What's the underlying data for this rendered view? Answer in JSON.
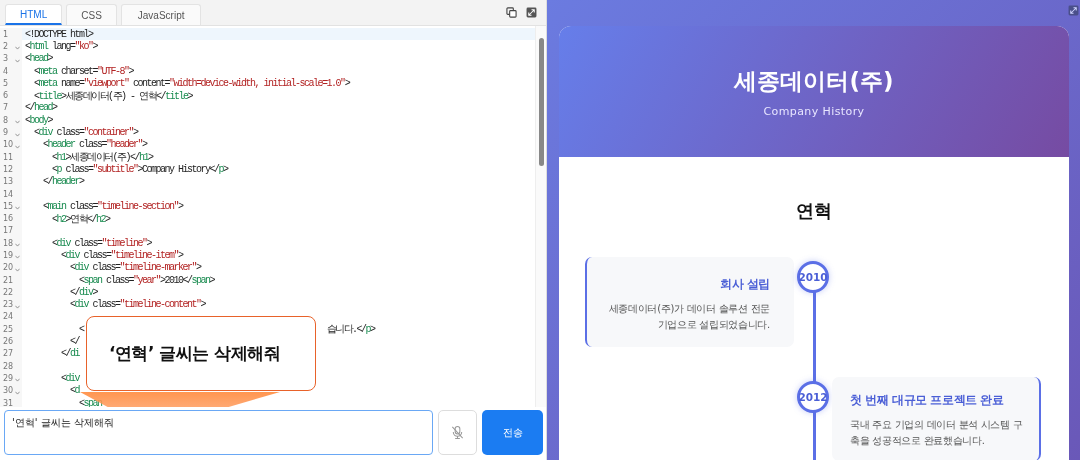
{
  "editor": {
    "tabs": [
      {
        "label": "HTML",
        "selected": true
      },
      {
        "label": "CSS",
        "selected": false
      },
      {
        "label": "JavaScript",
        "selected": false
      }
    ],
    "lines": [
      {
        "number": "1",
        "foldable": false,
        "current": true,
        "segments": [
          {
            "kind": "plain",
            "text": "<!DOCTYPE html>"
          }
        ]
      },
      {
        "number": "2",
        "foldable": true,
        "current": false,
        "segments": [
          {
            "kind": "plain",
            "text": "<"
          },
          {
            "kind": "tag",
            "text": "html"
          },
          {
            "kind": "plain",
            "text": " lang="
          },
          {
            "kind": "string",
            "text": "\"ko\""
          },
          {
            "kind": "plain",
            "text": ">"
          }
        ]
      },
      {
        "number": "3",
        "foldable": true,
        "current": false,
        "segments": [
          {
            "kind": "plain",
            "text": "<"
          },
          {
            "kind": "tag",
            "text": "head"
          },
          {
            "kind": "plain",
            "text": ">"
          }
        ]
      },
      {
        "number": "4",
        "foldable": false,
        "current": false,
        "segments": [
          {
            "kind": "plain",
            "text": "  <"
          },
          {
            "kind": "tag",
            "text": "meta"
          },
          {
            "kind": "plain",
            "text": " charset="
          },
          {
            "kind": "string",
            "text": "\"UTF-8\""
          },
          {
            "kind": "plain",
            "text": ">"
          }
        ]
      },
      {
        "number": "5",
        "foldable": false,
        "current": false,
        "segments": [
          {
            "kind": "plain",
            "text": "  <"
          },
          {
            "kind": "tag",
            "text": "meta"
          },
          {
            "kind": "plain",
            "text": " name="
          },
          {
            "kind": "string",
            "text": "\"viewport\""
          },
          {
            "kind": "plain",
            "text": " content="
          },
          {
            "kind": "string",
            "text": "\"width=device-width, initial-scale=1.0\""
          },
          {
            "kind": "plain",
            "text": ">"
          }
        ]
      },
      {
        "number": "6",
        "foldable": false,
        "current": false,
        "segments": [
          {
            "kind": "plain",
            "text": "  <"
          },
          {
            "kind": "tag",
            "text": "title"
          },
          {
            "kind": "plain",
            "text": ">세종데이터(주) - 연혁</"
          },
          {
            "kind": "tag",
            "text": "title"
          },
          {
            "kind": "plain",
            "text": ">"
          }
        ]
      },
      {
        "number": "7",
        "foldable": false,
        "current": false,
        "segments": [
          {
            "kind": "plain",
            "text": "</"
          },
          {
            "kind": "tag",
            "text": "head"
          },
          {
            "kind": "plain",
            "text": ">"
          }
        ]
      },
      {
        "number": "8",
        "foldable": true,
        "current": false,
        "segments": [
          {
            "kind": "plain",
            "text": "<"
          },
          {
            "kind": "tag",
            "text": "body"
          },
          {
            "kind": "plain",
            "text": ">"
          }
        ]
      },
      {
        "number": "9",
        "foldable": true,
        "current": false,
        "segments": [
          {
            "kind": "plain",
            "text": "  <"
          },
          {
            "kind": "tag",
            "text": "div"
          },
          {
            "kind": "plain",
            "text": " class="
          },
          {
            "kind": "string",
            "text": "\"container\""
          },
          {
            "kind": "plain",
            "text": ">"
          }
        ]
      },
      {
        "number": "10",
        "foldable": true,
        "current": false,
        "segments": [
          {
            "kind": "plain",
            "text": "    <"
          },
          {
            "kind": "tag",
            "text": "header"
          },
          {
            "kind": "plain",
            "text": " class="
          },
          {
            "kind": "string",
            "text": "\"header\""
          },
          {
            "kind": "plain",
            "text": ">"
          }
        ]
      },
      {
        "number": "11",
        "foldable": false,
        "current": false,
        "segments": [
          {
            "kind": "plain",
            "text": "      <"
          },
          {
            "kind": "tag",
            "text": "h1"
          },
          {
            "kind": "plain",
            "text": ">세종데이터(주)</"
          },
          {
            "kind": "tag",
            "text": "h1"
          },
          {
            "kind": "plain",
            "text": ">"
          }
        ]
      },
      {
        "number": "12",
        "foldable": false,
        "current": false,
        "segments": [
          {
            "kind": "plain",
            "text": "      <"
          },
          {
            "kind": "tag",
            "text": "p"
          },
          {
            "kind": "plain",
            "text": " class="
          },
          {
            "kind": "string",
            "text": "\"subtitle\""
          },
          {
            "kind": "plain",
            "text": ">Company History</"
          },
          {
            "kind": "tag",
            "text": "p"
          },
          {
            "kind": "plain",
            "text": ">"
          }
        ]
      },
      {
        "number": "13",
        "foldable": false,
        "current": false,
        "segments": [
          {
            "kind": "plain",
            "text": "    </"
          },
          {
            "kind": "tag",
            "text": "header"
          },
          {
            "kind": "plain",
            "text": ">"
          }
        ]
      },
      {
        "number": "14",
        "foldable": false,
        "current": false
      },
      {
        "number": "15",
        "foldable": true,
        "current": false,
        "segments": [
          {
            "kind": "plain",
            "text": "    <"
          },
          {
            "kind": "tag",
            "text": "main"
          },
          {
            "kind": "plain",
            "text": " class="
          },
          {
            "kind": "string",
            "text": "\"timeline-section\""
          },
          {
            "kind": "plain",
            "text": ">"
          }
        ]
      },
      {
        "number": "16",
        "foldable": false,
        "current": false,
        "segments": [
          {
            "kind": "plain",
            "text": "      <"
          },
          {
            "kind": "tag",
            "text": "h2"
          },
          {
            "kind": "plain",
            "text": ">연혁</"
          },
          {
            "kind": "tag",
            "text": "h2"
          },
          {
            "kind": "plain",
            "text": ">"
          }
        ]
      },
      {
        "number": "17",
        "foldable": false,
        "current": false
      },
      {
        "number": "18",
        "foldable": true,
        "current": false,
        "segments": [
          {
            "kind": "plain",
            "text": "      <"
          },
          {
            "kind": "tag",
            "text": "div"
          },
          {
            "kind": "plain",
            "text": " class="
          },
          {
            "kind": "string",
            "text": "\"timeline\""
          },
          {
            "kind": "plain",
            "text": ">"
          }
        ]
      },
      {
        "number": "19",
        "foldable": true,
        "current": false,
        "segments": [
          {
            "kind": "plain",
            "text": "        <"
          },
          {
            "kind": "tag",
            "text": "div"
          },
          {
            "kind": "plain",
            "text": " class="
          },
          {
            "kind": "string",
            "text": "\"timeline-item\""
          },
          {
            "kind": "plain",
            "text": ">"
          }
        ]
      },
      {
        "number": "20",
        "foldable": true,
        "current": false,
        "segments": [
          {
            "kind": "plain",
            "text": "          <"
          },
          {
            "kind": "tag",
            "text": "div"
          },
          {
            "kind": "plain",
            "text": " class="
          },
          {
            "kind": "string",
            "text": "\"timeline-marker\""
          },
          {
            "kind": "plain",
            "text": ">"
          }
        ]
      },
      {
        "number": "21",
        "foldable": false,
        "current": false,
        "segments": [
          {
            "kind": "plain",
            "text": "            <"
          },
          {
            "kind": "tag",
            "text": "span"
          },
          {
            "kind": "plain",
            "text": " class="
          },
          {
            "kind": "string",
            "text": "\"year\""
          },
          {
            "kind": "plain",
            "text": ">2010</"
          },
          {
            "kind": "tag",
            "text": "span"
          },
          {
            "kind": "plain",
            "text": ">"
          }
        ]
      },
      {
        "number": "22",
        "foldable": false,
        "current": false,
        "segments": [
          {
            "kind": "plain",
            "text": "          </"
          },
          {
            "kind": "tag",
            "text": "div"
          },
          {
            "kind": "plain",
            "text": ">"
          }
        ]
      },
      {
        "number": "23",
        "foldable": true,
        "current": false,
        "segments": [
          {
            "kind": "plain",
            "text": "          <"
          },
          {
            "kind": "tag",
            "text": "div"
          },
          {
            "kind": "plain",
            "text": " class="
          },
          {
            "kind": "string",
            "text": "\"timeline-content\""
          },
          {
            "kind": "plain",
            "text": ">"
          }
        ]
      },
      {
        "number": "24",
        "foldable": false,
        "current": false
      },
      {
        "number": "25",
        "foldable": false,
        "current": false,
        "segments": [
          {
            "kind": "plain",
            "text": "            <"
          }
        ],
        "tail": [
          {
            "kind": "plain",
            "text": "습니다.</"
          },
          {
            "kind": "tag",
            "text": "p"
          },
          {
            "kind": "plain",
            "text": ">"
          }
        ]
      },
      {
        "number": "26",
        "foldable": false,
        "current": false,
        "segments": [
          {
            "kind": "plain",
            "text": "          </"
          }
        ]
      },
      {
        "number": "27",
        "foldable": false,
        "current": false,
        "segments": [
          {
            "kind": "plain",
            "text": "        </"
          },
          {
            "kind": "tag",
            "text": "di"
          }
        ]
      },
      {
        "number": "28",
        "foldable": false,
        "current": false
      },
      {
        "number": "29",
        "foldable": true,
        "current": false,
        "segments": [
          {
            "kind": "plain",
            "text": "        <"
          },
          {
            "kind": "tag",
            "text": "div"
          }
        ]
      },
      {
        "number": "30",
        "foldable": true,
        "current": false,
        "segments": [
          {
            "kind": "plain",
            "text": "          <"
          },
          {
            "kind": "tag",
            "text": "d"
          }
        ]
      },
      {
        "number": "31",
        "foldable": false,
        "current": false,
        "segments": [
          {
            "kind": "plain",
            "text": "            <"
          },
          {
            "kind": "tag",
            "text": "span"
          }
        ]
      }
    ],
    "prompt": {
      "value": "'연혁' 글씨는 삭제해줘"
    },
    "send_button": "전송"
  },
  "callout": {
    "text": "‘연혁’ 글씨는 삭제해줘"
  },
  "preview": {
    "title": "세종데이터(주)",
    "subtitle": "Company History",
    "section_title": "연혁",
    "events": [
      {
        "kind": "left",
        "year": "2010",
        "title": "회사 설립",
        "description": "세종데이터(주)가 데이터 솔루션 전문 기업으로 설립되었습니다."
      },
      {
        "kind": "right",
        "year": "2012",
        "title": "첫 번째 대규모 프로젝트 완료",
        "description": "국내 주요 기업의 데이터 분석 시스템 구축을 성공적으로 완료했습니다."
      }
    ]
  }
}
